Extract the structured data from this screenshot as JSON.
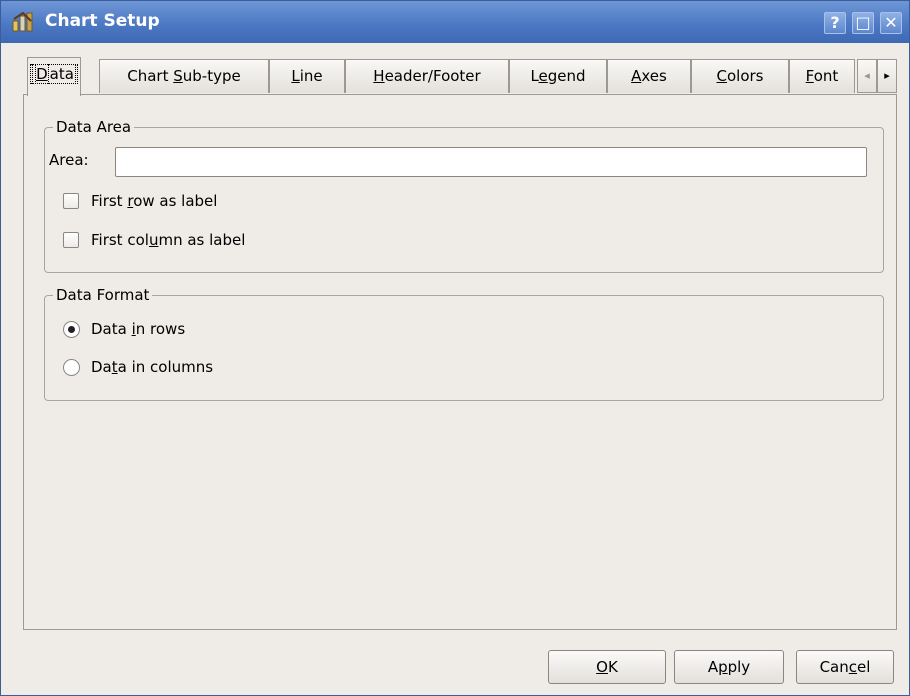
{
  "window": {
    "title": "Chart Setup"
  },
  "title_buttons": {
    "help": "?",
    "maximize": "□",
    "close": "✕"
  },
  "tabs": [
    {
      "pre": "",
      "key": "D",
      "post": "ata"
    },
    {
      "pre": "Chart ",
      "key": "S",
      "post": "ub-type"
    },
    {
      "pre": "",
      "key": "L",
      "post": "ine"
    },
    {
      "pre": "",
      "key": "H",
      "post": "eader/Footer"
    },
    {
      "pre": "L",
      "key": "e",
      "post": "gend"
    },
    {
      "pre": "",
      "key": "A",
      "post": "xes"
    },
    {
      "pre": "",
      "key": "C",
      "post": "olors"
    },
    {
      "pre": "",
      "key": "F",
      "post": "ont"
    }
  ],
  "tab_scroll": {
    "left": "◂",
    "right": "▸"
  },
  "data_area": {
    "legend": "Data Area",
    "area_label": "Area:",
    "area_value": "",
    "first_row": {
      "pre": "First ",
      "key": "r",
      "post": "ow as label"
    },
    "first_column": {
      "pre": "First col",
      "key": "u",
      "post": "mn as label"
    }
  },
  "data_format": {
    "legend": "Data Format",
    "rows": {
      "pre": "Data ",
      "key": "i",
      "post": "n rows"
    },
    "columns": {
      "pre": "Da",
      "key": "t",
      "post": "a in columns"
    }
  },
  "buttons": {
    "ok": {
      "pre": "",
      "key": "O",
      "post": "K"
    },
    "apply": {
      "pre": "A",
      "key": "p",
      "post": "ply"
    },
    "cancel": {
      "pre": "Can",
      "key": "c",
      "post": "el"
    }
  }
}
